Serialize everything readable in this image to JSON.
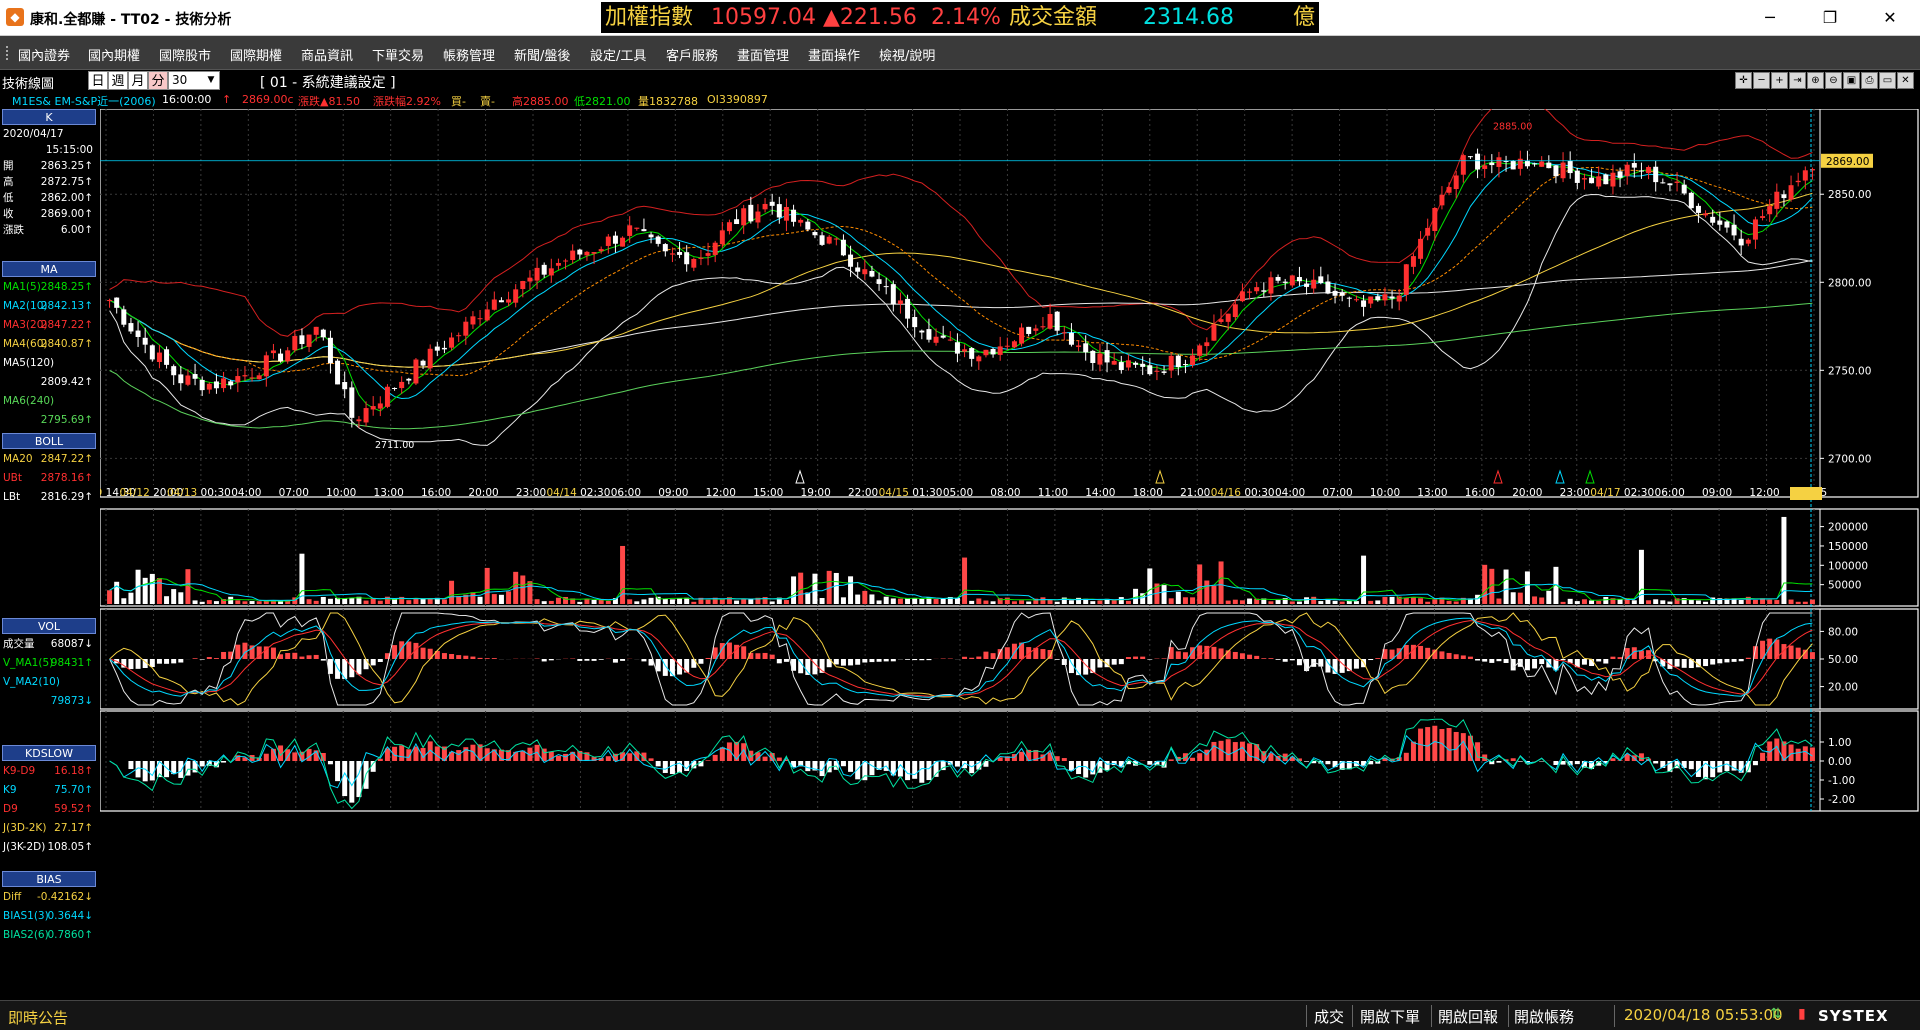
{
  "app": {
    "title": "康和.全都賺 - TT02 - 技術分析",
    "logo": "app-logo-icon"
  },
  "ticker": {
    "name": "加權指數",
    "index": "10597.04",
    "change": "▲221.56",
    "change_pct": "2.14%",
    "volume_label": "成交金額",
    "volume": "2314.68",
    "unit": "億",
    "colors": {
      "name": "#f5d142",
      "index": "#ff4040",
      "change": "#ff4040",
      "pct": "#ff4040",
      "vol_label": "#f5d142",
      "vol": "#00e0e0",
      "unit": "#f5d142"
    }
  },
  "window_controls": {
    "minimize": "─",
    "restore": "❐",
    "close": "✕"
  },
  "menu": [
    "國內證券",
    "國內期權",
    "國際股市",
    "國際期權",
    "商品資訊",
    "下單交易",
    "帳務管理",
    "新聞/盤後",
    "設定/工具",
    "客戶服務",
    "畫面管理",
    "畫面操作",
    "檢視/說明"
  ],
  "chart_toolbar": {
    "window_title": "技術線圖",
    "periods": [
      "日",
      "週",
      "月",
      "分"
    ],
    "active_period": "分",
    "period_value": "30",
    "suggest_setting": "[ 01 - 系統建議設定 ]"
  },
  "quote_line": {
    "symbol": "M1ES&  EM-S&P近一(2006)",
    "time": "16:00:00",
    "arrow": "↑",
    "price": "2869.00c",
    "change": "漲跌▲81.50",
    "change_pct": "漲跌幅2.92%",
    "bid": "買-",
    "ask": "賣-",
    "high": "高2885.00",
    "low": "低2821.00",
    "volume": "量1832788",
    "oi": "OI3390897"
  },
  "left_panel": {
    "k": {
      "title": "K",
      "date": "2020/04/17",
      "time": "15:15:00",
      "rows": [
        {
          "label": "開",
          "value": "2863.25↑"
        },
        {
          "label": "高",
          "value": "2872.75↑"
        },
        {
          "label": "低",
          "value": "2862.00↑"
        },
        {
          "label": "收",
          "value": "2869.00↑"
        },
        {
          "label": "漲跌",
          "value": "6.00↑"
        }
      ]
    },
    "ma": {
      "title": "MA",
      "rows": [
        {
          "label": "MA1(5)",
          "value": "2848.25↑",
          "color": "#00e000"
        },
        {
          "label": "MA2(10)",
          "value": "2842.13↑",
          "color": "#00d8ff"
        },
        {
          "label": "MA3(20)",
          "value": "2847.22↑",
          "color": "#ff3030"
        },
        {
          "label": "MA4(60)",
          "value": "2840.87↑",
          "color": "#f5d142"
        },
        {
          "label": "MA5(120)",
          "value": "",
          "color": "#ffffff"
        },
        {
          "label": "",
          "value": "2809.42↑",
          "color": "#ffffff"
        },
        {
          "label": "MA6(240)",
          "value": "",
          "color": "#58d858"
        },
        {
          "label": "",
          "value": "2795.69↑",
          "color": "#58d858"
        }
      ]
    },
    "boll": {
      "title": "BOLL",
      "rows": [
        {
          "label": "MA20",
          "value": "2847.22↑",
          "color": "#f5d142"
        },
        {
          "label": "UBt",
          "value": "2878.16↑",
          "color": "#ff3030"
        },
        {
          "label": "LBt",
          "value": "2816.29↑",
          "color": "#ffffff"
        }
      ]
    },
    "vol": {
      "title": "VOL",
      "rows": [
        {
          "label": "成交量",
          "value": "68087↓",
          "color": "#ffffff"
        },
        {
          "label": "V_MA1(5)",
          "value": "98431↑",
          "color": "#00e000"
        },
        {
          "label": "V_MA2(10)",
          "value": "",
          "color": "#00d8ff"
        },
        {
          "label": "",
          "value": "79873↓",
          "color": "#00d8ff"
        }
      ]
    },
    "kd": {
      "title": "KDSLOW",
      "rows": [
        {
          "label": "K9-D9",
          "value": "16.18↑",
          "color": "#ff3030"
        },
        {
          "label": "K9",
          "value": "75.70↑",
          "color": "#00d8ff"
        },
        {
          "label": "D9",
          "value": "59.52↑",
          "color": "#ff3030"
        },
        {
          "label": "J(3D-2K)",
          "value": "27.17↑",
          "color": "#f5d142"
        },
        {
          "label": "J(3K-2D)",
          "value": "108.05↑",
          "color": "#ffffff"
        }
      ]
    },
    "bias": {
      "title": "BIAS",
      "rows": [
        {
          "label": "Diff",
          "value": "-0.42162↓",
          "color": "#f5d142"
        },
        {
          "label": "BIAS1(3)",
          "value": "0.3644↓",
          "color": "#00d8ff"
        },
        {
          "label": "BIAS2(6)",
          "value": "0.7860↑",
          "color": "#00e0a0"
        }
      ]
    }
  },
  "chart_data": {
    "type": "candlestick",
    "price_axis": [
      "2850.00",
      "2800.00",
      "2750.00",
      "2700.00"
    ],
    "price_axis_values": [
      2850,
      2800,
      2750,
      2700
    ],
    "ylim": [
      2686,
      2895
    ],
    "current_price_label": "2869.00",
    "current_price": 2869,
    "annotations": [
      {
        "text": "2885.00",
        "value": 2885
      },
      {
        "text": "2711.00",
        "value": 2711
      }
    ],
    "time_axis": [
      "04/09 14:30",
      "04/12 20:00",
      "04/13 00:30",
      "04:00",
      "07:00",
      "10:00",
      "13:00",
      "16:00",
      "20:00",
      "23:00",
      "04/14 02:30",
      "06:00",
      "09:00",
      "12:00",
      "15:00",
      "19:00",
      "22:00",
      "04/15 01:30",
      "05:00",
      "08:00",
      "11:00",
      "14:00",
      "18:00",
      "21:00",
      "04/16 00:30",
      "04:00",
      "07:00",
      "10:00",
      "13:00",
      "16:00",
      "20:00",
      "23:00",
      "04/17 02:30",
      "06:00",
      "09:00",
      "12:00",
      "15:15"
    ],
    "close_trace": [
      2790,
      2765,
      2745,
      2742,
      2748,
      2760,
      2775,
      2722,
      2738,
      2755,
      2770,
      2790,
      2800,
      2812,
      2820,
      2830,
      2815,
      2815,
      2835,
      2845,
      2830,
      2820,
      2800,
      2782,
      2765,
      2760,
      2768,
      2782,
      2762,
      2752,
      2750,
      2758,
      2780,
      2798,
      2800,
      2795,
      2785,
      2792,
      2835,
      2870,
      2866,
      2870,
      2862,
      2858,
      2865,
      2855,
      2838,
      2825,
      2848,
      2869
    ],
    "volume_axis": [
      "200000",
      "150000",
      "100000",
      "50000"
    ],
    "volume_axis_values": [
      200000,
      150000,
      100000,
      50000
    ],
    "kd_axis": [
      "80.00",
      "50.00",
      "20.00"
    ],
    "kd_axis_values": [
      80,
      50,
      20
    ],
    "bias_axis": [
      "1.00",
      "0.00",
      "-1.00",
      "-2.00"
    ],
    "bias_axis_values": [
      1,
      0,
      -1,
      -2
    ]
  },
  "status_bar": {
    "announcement": "即時公告",
    "buttons": [
      "成交",
      "開啟下單",
      "開啟回報",
      "開啟帳務"
    ],
    "clock": "2020/04/18 05:53:00",
    "brand": "SYSTEX"
  }
}
